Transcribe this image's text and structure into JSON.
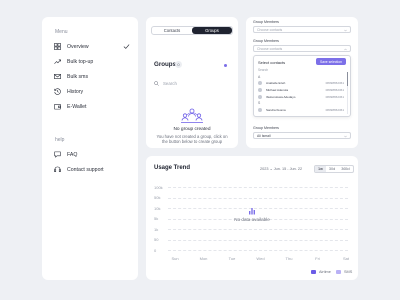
{
  "sidebar": {
    "menu_label": "Menu",
    "items": [
      {
        "label": "Overview",
        "icon": "grid-icon",
        "selected": true
      },
      {
        "label": "Bulk top-up",
        "icon": "trend-up-icon"
      },
      {
        "label": "Bulk sms",
        "icon": "mail-icon"
      },
      {
        "label": "History",
        "icon": "history-icon"
      },
      {
        "label": "E-Wallet",
        "icon": "wallet-icon"
      }
    ],
    "help_label": "help",
    "help_items": [
      {
        "label": "FAQ",
        "icon": "chat-icon"
      },
      {
        "label": "Contact support",
        "icon": "headset-icon"
      }
    ]
  },
  "groups": {
    "tabs": [
      "Contacts",
      "Groups"
    ],
    "active_tab": "Groups",
    "title": "Groups",
    "count": "0",
    "search_placeholder": "Search",
    "empty_title": "No group created",
    "empty_desc": "You have not created a group, click on the button below to create group"
  },
  "members": {
    "group_members_label": "Group Members",
    "choose_members_placeholder": "Choose contacts",
    "select_contacts_title": "Select contacts",
    "save_button": "Save selection",
    "search_placeholder": "Search",
    "contacts": [
      {
        "letter": "A",
        "name": "Anabelle Ezeh",
        "phone": "08098652361"
      },
      {
        "name": "Michael Adenola",
        "phone": "08098652361"
      },
      {
        "name": "Ibukunoluwa Adedayo",
        "phone": "08098652361"
      },
      {
        "letter": "S",
        "name": "Sandra Ifeoma",
        "phone": "08098652361"
      }
    ],
    "group_members_label_2": "Group Members",
    "admin_value": "Ali Ismail"
  },
  "usage": {
    "title": "Usage Trend",
    "year": "2023",
    "date_range": "Jun. 15 - Jun. 22",
    "range_options": [
      "1w",
      "30d",
      "365d"
    ],
    "active_range": "1w",
    "no_data": "No data available",
    "legend": [
      {
        "label": "Airtime",
        "color": "#6b5ce7"
      },
      {
        "label": "SMS",
        "color": "#b9b1f5"
      }
    ]
  },
  "chart_data": {
    "type": "bar",
    "title": "Usage Trend",
    "categories": [
      "Sun",
      "Mon",
      "Tue",
      "Wed",
      "Thu",
      "Fri",
      "Sat"
    ],
    "y_ticks": [
      "100k",
      "50k",
      "10k",
      "5k",
      "1k",
      "50",
      "0"
    ],
    "series": [
      {
        "name": "Airtime",
        "values": []
      },
      {
        "name": "SMS",
        "values": []
      }
    ],
    "grid": true,
    "legend_position": "bottom-right"
  }
}
